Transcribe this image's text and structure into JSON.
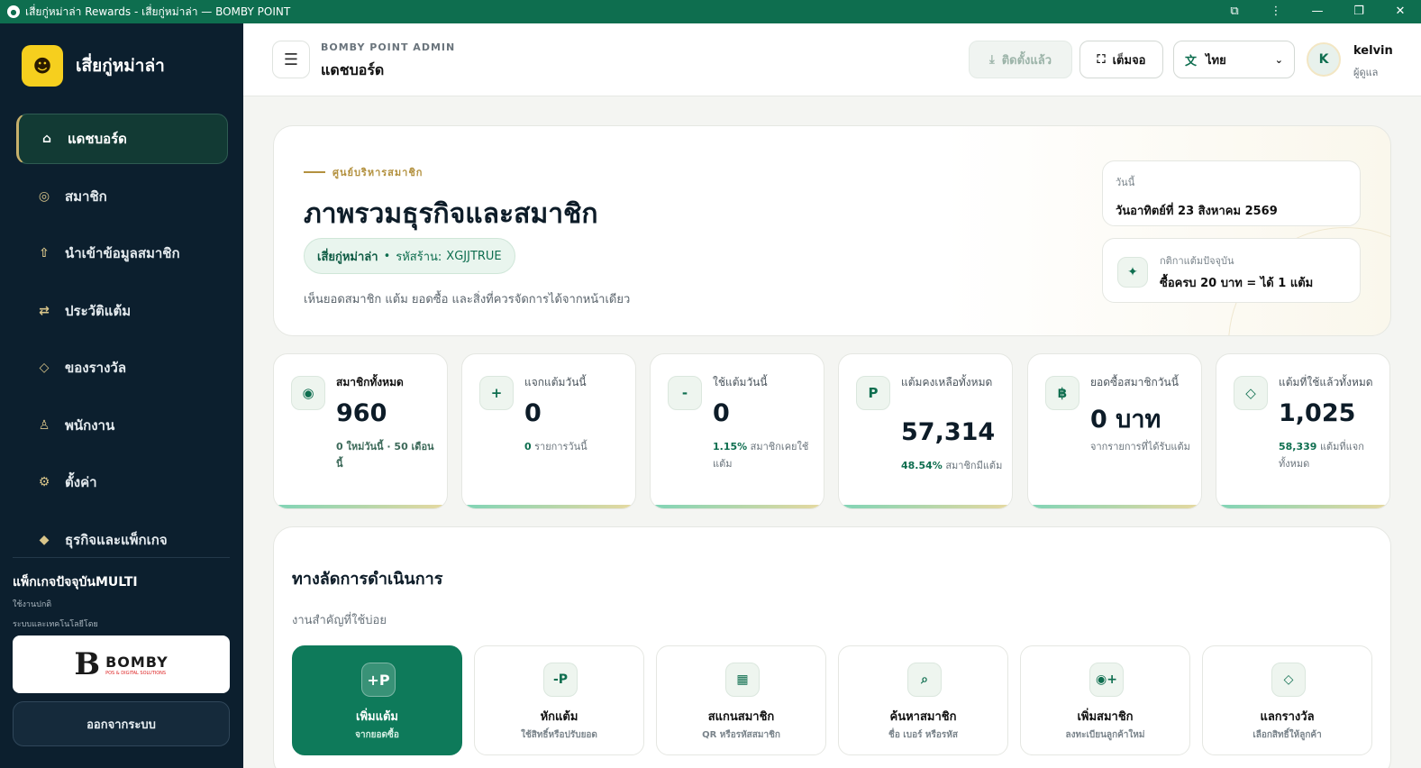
{
  "browser": {
    "title": "เสี่ยกู่หม่าล่า Rewards - เสี่ยกู่หม่าล่า — BOMBY POINT",
    "controls": [
      "⧉",
      "⋮",
      "—",
      "❐",
      "✕"
    ]
  },
  "sidebar": {
    "brand_name": "เสี่ยกู่หม่าล่า",
    "items": [
      {
        "label": "แดชบอร์ด",
        "icon": "⌂"
      },
      {
        "label": "สมาชิก",
        "icon": "◎"
      },
      {
        "label": "นำเข้าข้อมูลสมาชิก",
        "icon": "⇧"
      },
      {
        "label": "ประวัติแต้ม",
        "icon": "⇄"
      },
      {
        "label": "ของรางวัล",
        "icon": "◇"
      },
      {
        "label": "พนักงาน",
        "icon": "♙"
      },
      {
        "label": "ตั้งค่า",
        "icon": "⚙"
      },
      {
        "label": "ธุรกิจและแพ็กเกจ",
        "icon": "◆"
      }
    ],
    "package_title": "แพ็กเกจปัจจุบันMULTI",
    "package_status": "ใช้งานปกติ",
    "powered_label": "ระบบและเทคโนโลยีโดย",
    "partner_mark": "B",
    "partner_name": "BOMBY",
    "partner_tagline": "POS & DIGITAL SOLUTIONS",
    "logout_label": "ออกจากระบบ"
  },
  "header": {
    "menu_icon": "☰",
    "breadcrumb": "BOMBY POINT ADMIN",
    "title": "แดชบอร์ด",
    "install_icon": "⤓",
    "install_label": "ติดตั้งแล้ว",
    "fullscreen_icon": "⛶",
    "fullscreen_label": "เต็มจอ",
    "language_icon": "文",
    "language": "ไทย",
    "language_caret": "⌄",
    "avatar_initial": "K",
    "user_name": "kelvin",
    "user_role": "ผู้ดูแล"
  },
  "hero": {
    "eyebrow": "ศูนย์บริหารสมาชิก",
    "title": "ภาพรวมธุรกิจและสมาชิก",
    "shop_name": "เสี่ยกู่หม่าล่า",
    "separator": "•",
    "shop_code_label": "รหัสร้าน:",
    "shop_code": "XGJJTRUE",
    "description": "เห็นยอดสมาชิก แต้ม ยอดซื้อ และสิ่งที่ควรจัดการได้จากหน้าเดียว",
    "date_label": "วันนี้",
    "date_value": "วันอาทิตย์ที่ 23 สิงหาคม 2569",
    "rule_icon": "✦",
    "rule_label": "กติกาแต้มปัจจุบัน",
    "rule_value": "ซื้อครบ 20 บาท = ได้ 1 แต้ม"
  },
  "stats": [
    {
      "icon": "◉",
      "label": "สมาชิกทั้งหมด",
      "value": "960",
      "note_strong": "",
      "note": "0 ใหม่วันนี้ · 50 เดือนนี้"
    },
    {
      "icon": "+",
      "label": "แจกแต้มวันนี้",
      "value": "0",
      "note_strong": "0",
      "note": " รายการวันนี้"
    },
    {
      "icon": "-",
      "label": "ใช้แต้มวันนี้",
      "value": "0",
      "note_strong": "1.15%",
      "note": " สมาชิกเคยใช้แต้ม"
    },
    {
      "icon": "P",
      "label": "แต้มคงเหลือทั้งหมด",
      "value": "57,314",
      "note_strong": "48.54%",
      "note": " สมาชิกมีแต้ม"
    },
    {
      "icon": "฿",
      "label": "ยอดซื้อสมาชิกวันนี้",
      "value": "0 บาท",
      "note_strong": "",
      "note": "จากรายการที่ได้รับแต้ม"
    },
    {
      "icon": "◇",
      "label": "แต้มที่ใช้แล้วทั้งหมด",
      "value": "1,025",
      "note_strong": "58,339",
      "note": " แต้มที่แจกทั้งหมด"
    }
  ],
  "shortcuts": {
    "title": "ทางลัดการดำเนินการ",
    "subtitle": "งานสำคัญที่ใช้บ่อย",
    "tiles": [
      {
        "icon": "+P",
        "label": "เพิ่มแต้ม",
        "sub": "จากยอดซื้อ"
      },
      {
        "icon": "-P",
        "label": "หักแต้ม",
        "sub": "ใช้สิทธิ์หรือปรับยอด"
      },
      {
        "icon": "▦",
        "label": "สแกนสมาชิก",
        "sub": "QR หรือรหัสสมาชิก"
      },
      {
        "icon": "⌕",
        "label": "ค้นหาสมาชิก",
        "sub": "ชื่อ เบอร์ หรือรหัส"
      },
      {
        "icon": "◉+",
        "label": "เพิ่มสมาชิก",
        "sub": "ลงทะเบียนลูกค้าใหม่"
      },
      {
        "icon": "◇",
        "label": "แลกรางวัล",
        "sub": "เลือกสิทธิ์ให้ลูกค้า"
      }
    ]
  }
}
